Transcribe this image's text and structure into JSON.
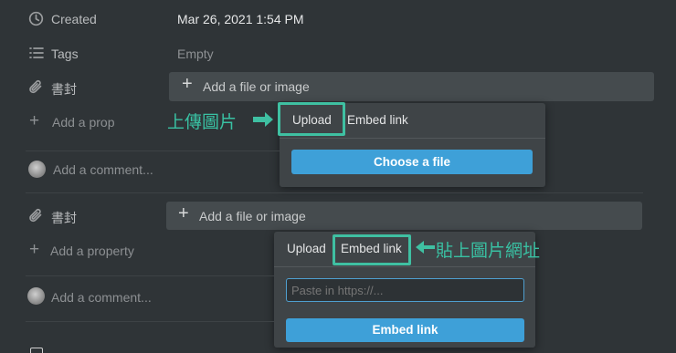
{
  "properties": {
    "created_label": "Created",
    "created_value": "Mar 26, 2021 1:54 PM",
    "tags_label": "Tags",
    "tags_value": "Empty",
    "cover_label": "書封",
    "add_property": "Add a prop",
    "add_property_full": "Add a property",
    "add_comment": "Add a comment..."
  },
  "add_file": {
    "label": "Add a file or image"
  },
  "upload_popup": {
    "tabs": [
      "Upload",
      "Embed link"
    ],
    "active_tab": "Upload",
    "button_label": "Choose a file"
  },
  "embed_popup": {
    "tabs": [
      "Upload",
      "Embed link"
    ],
    "active_tab": "Embed link",
    "input_placeholder": "Paste in https://...",
    "button_label": "Embed link"
  },
  "annotations": {
    "upload_note": "上傳圖片",
    "embed_note": "貼上圖片網址",
    "accent": "#3fc0a2"
  },
  "colors": {
    "background": "#2f3437",
    "button_blue": "#3ea0d8"
  },
  "icons": [
    "clock-icon",
    "list-icon",
    "paperclip-icon",
    "plus-icon",
    "arrow-right-icon",
    "arrow-left-icon"
  ]
}
